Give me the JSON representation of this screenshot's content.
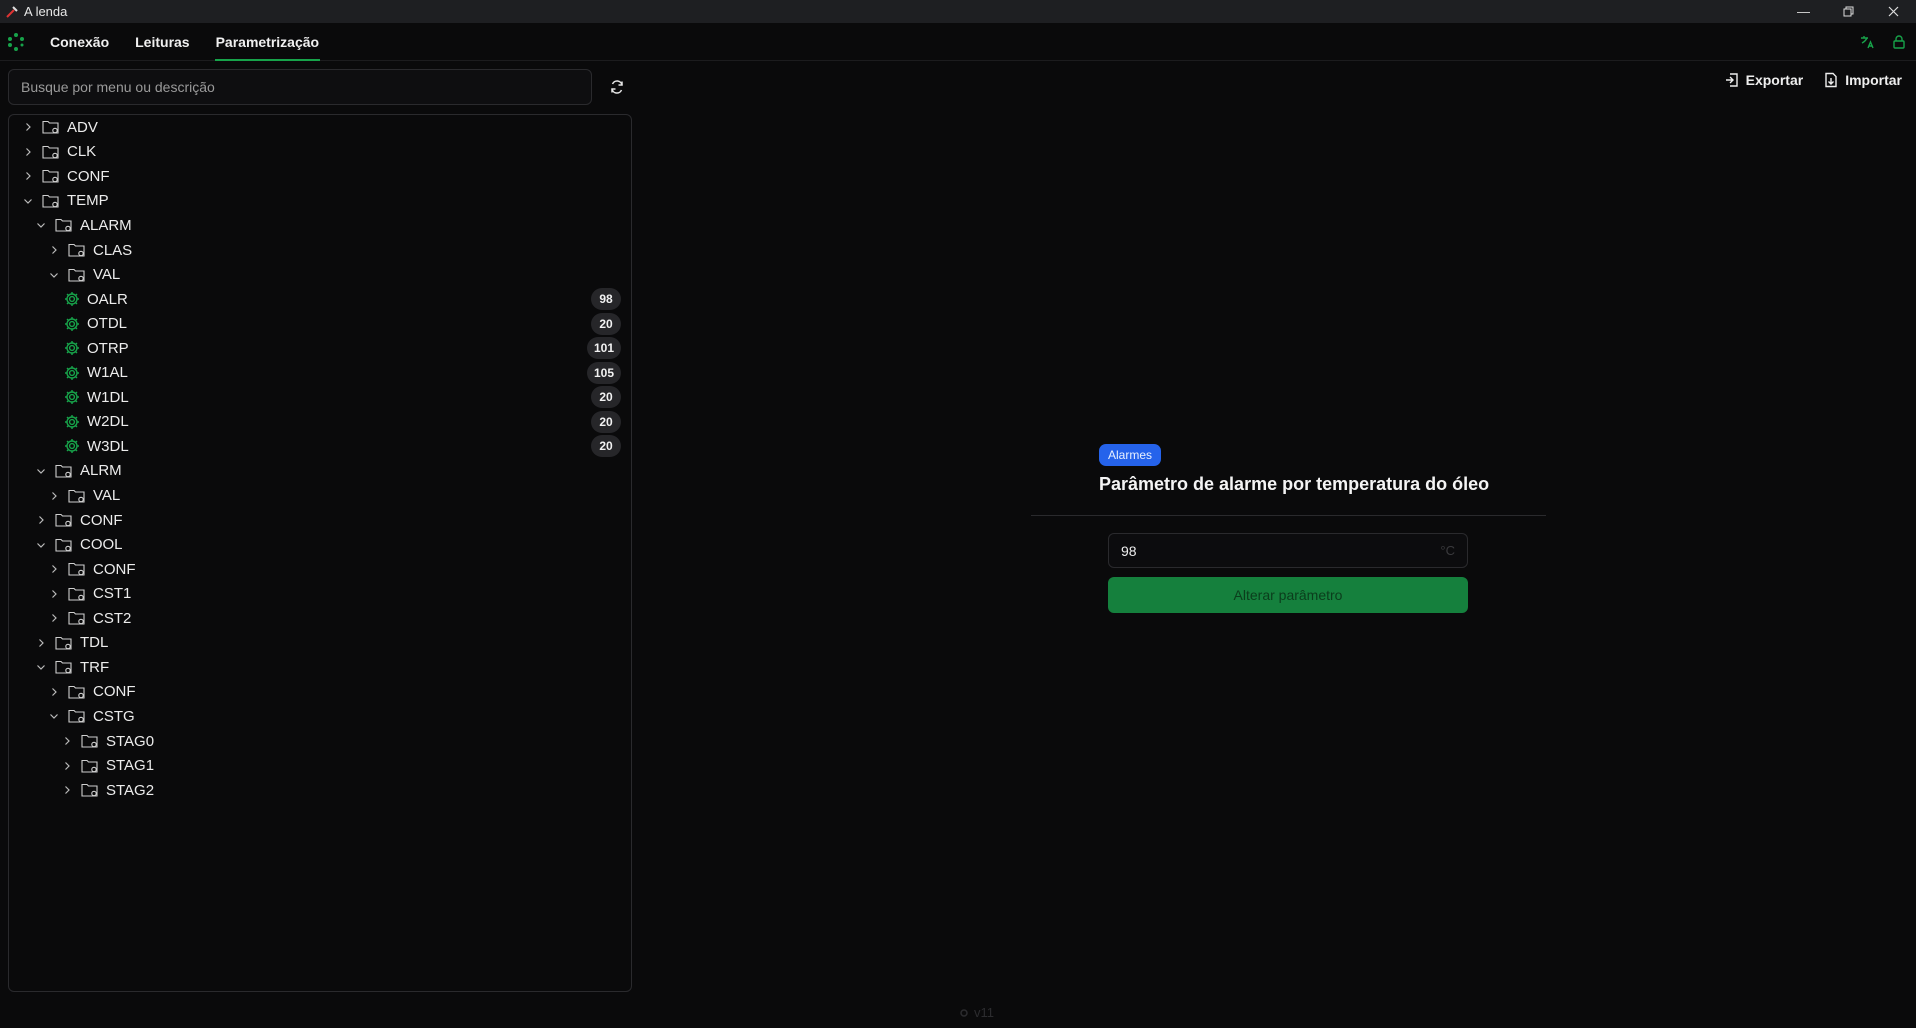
{
  "window": {
    "title": "A lenda",
    "controls": [
      "minimize",
      "restore",
      "close"
    ]
  },
  "nav": {
    "tabs": [
      "Conexão",
      "Leituras",
      "Parametrização"
    ],
    "active_tab": "Parametrização"
  },
  "search": {
    "placeholder": "Busque por menu ou descrição",
    "value": ""
  },
  "actions": {
    "export_label": "Exportar",
    "import_label": "Importar"
  },
  "tree": [
    {
      "label": "ADV",
      "level": 0,
      "type": "folder",
      "expanded": false
    },
    {
      "label": "CLK",
      "level": 0,
      "type": "folder",
      "expanded": false
    },
    {
      "label": "CONF",
      "level": 0,
      "type": "folder",
      "expanded": false
    },
    {
      "label": "TEMP",
      "level": 0,
      "type": "folder",
      "expanded": true
    },
    {
      "label": "ALARM",
      "level": 1,
      "type": "folder",
      "expanded": true
    },
    {
      "label": "CLAS",
      "level": 2,
      "type": "folder",
      "expanded": false
    },
    {
      "label": "VAL",
      "level": 2,
      "type": "folder",
      "expanded": true
    },
    {
      "label": "OALR",
      "level": 3,
      "type": "param",
      "value": "98"
    },
    {
      "label": "OTDL",
      "level": 3,
      "type": "param",
      "value": "20"
    },
    {
      "label": "OTRP",
      "level": 3,
      "type": "param",
      "value": "101"
    },
    {
      "label": "W1AL",
      "level": 3,
      "type": "param",
      "value": "105"
    },
    {
      "label": "W1DL",
      "level": 3,
      "type": "param",
      "value": "20"
    },
    {
      "label": "W2DL",
      "level": 3,
      "type": "param",
      "value": "20"
    },
    {
      "label": "W3DL",
      "level": 3,
      "type": "param",
      "value": "20"
    },
    {
      "label": "ALRM",
      "level": 1,
      "type": "folder",
      "expanded": true
    },
    {
      "label": "VAL",
      "level": 2,
      "type": "folder",
      "expanded": false
    },
    {
      "label": "CONF",
      "level": 1,
      "type": "folder",
      "expanded": false
    },
    {
      "label": "COOL",
      "level": 1,
      "type": "folder",
      "expanded": true
    },
    {
      "label": "CONF",
      "level": 2,
      "type": "folder",
      "expanded": false
    },
    {
      "label": "CST1",
      "level": 2,
      "type": "folder",
      "expanded": false
    },
    {
      "label": "CST2",
      "level": 2,
      "type": "folder",
      "expanded": false
    },
    {
      "label": "TDL",
      "level": 1,
      "type": "folder",
      "expanded": false
    },
    {
      "label": "TRF",
      "level": 1,
      "type": "folder",
      "expanded": true
    },
    {
      "label": "CONF",
      "level": 2,
      "type": "folder",
      "expanded": false
    },
    {
      "label": "CSTG",
      "level": 2,
      "type": "folder",
      "expanded": true
    },
    {
      "label": "STAG0",
      "level": 3,
      "type": "folder",
      "expanded": false
    },
    {
      "label": "STAG1",
      "level": 3,
      "type": "folder",
      "expanded": false
    },
    {
      "label": "STAG2",
      "level": 3,
      "type": "folder",
      "expanded": false
    }
  ],
  "detail": {
    "tag": "Alarmes",
    "title": "Parâmetro de alarme por temperatura do óleo",
    "value": "98",
    "unit": "°C",
    "button_label": "Alterar parâmetro"
  },
  "footer": {
    "version": "v11"
  },
  "colors": {
    "accent": "#17a34a",
    "tag": "#2563eb",
    "button": "#15803d",
    "background": "#0a0a0b"
  }
}
